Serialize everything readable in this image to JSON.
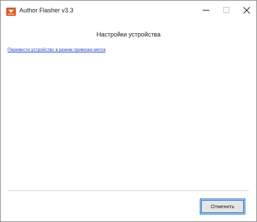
{
  "window": {
    "title": "Author Flasher v3.3",
    "icon": "app-logo-icon",
    "controls": {
      "minimize_icon": "minimize-icon",
      "maximize_icon": "maximize-icon",
      "close_icon": "close-icon"
    }
  },
  "main": {
    "heading": "Настройки устройства",
    "link_text": "Перевести устройство в режим привязки меток"
  },
  "footer": {
    "cancel_label": "Отменить"
  },
  "colors": {
    "link": "#1f3fd6",
    "button_focus_border": "#0a6fd6",
    "logo_orange": "#e8561c"
  }
}
